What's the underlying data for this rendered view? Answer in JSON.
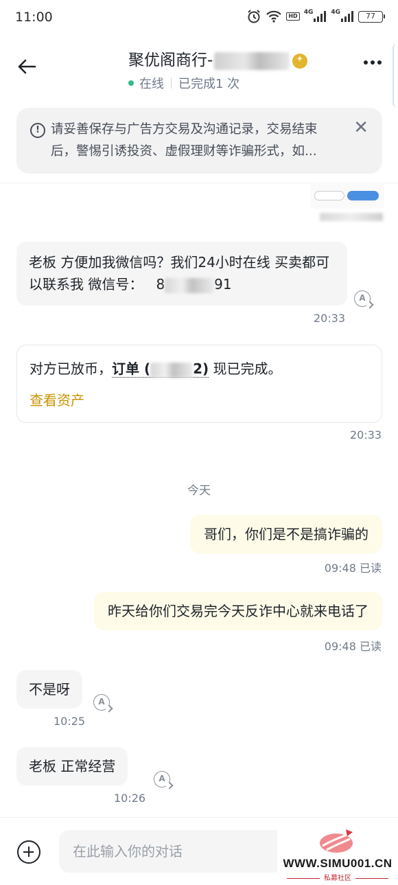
{
  "status_bar": {
    "time": "11:00",
    "hd_label": "HD",
    "net1": "4G",
    "net2": "4G",
    "battery": "77",
    "icons": [
      "alarm-icon",
      "wifi-icon",
      "hd-icon",
      "signal-icon",
      "signal-icon",
      "battery-icon"
    ]
  },
  "header": {
    "merchant_name": "聚优阁商行-",
    "online_status": "在线",
    "completed": "已完成1 次",
    "back_icon": "back-arrow-icon",
    "more_icon": "more-icon"
  },
  "notice": {
    "text": "请妥善保存与广告方交易及沟通记录，交易结束后，警惕引诱投资、虚假理财等诈骗形式，如..."
  },
  "messages": {
    "msg1": {
      "part1": "老板 方便加我微信吗？我们24小时在线 买卖都可以联系我 微信号：",
      "visible_start": "8",
      "visible_end": "91",
      "time": "20:33"
    },
    "order_card": {
      "prefix": "对方已放币，",
      "order_label": "订单",
      "order_open": "(",
      "order_close": "2)",
      "suffix": " 现已完成。",
      "link": "查看资产",
      "time": "20:33"
    },
    "day_separator": "今天",
    "msg3": {
      "text": "哥们，你们是不是搞诈骗的",
      "time": "09:48 已读"
    },
    "msg4": {
      "text": "昨天给你们交易完今天反诈中心就来电话了",
      "time": "09:48 已读"
    },
    "msg5": {
      "text": "不是呀",
      "time": "10:25"
    },
    "msg6": {
      "text": "老板   正常经营",
      "time": "10:26"
    }
  },
  "input": {
    "placeholder": "在此输入你的对话"
  },
  "watermark": {
    "text": "WWW.SIMU001.CN",
    "sub": "私募社区"
  },
  "colors": {
    "accent_gold": "#c99400",
    "online_green": "#2ebd85",
    "outgoing_bubble": "#fefbe8",
    "incoming_bubble": "#f5f5f5"
  }
}
